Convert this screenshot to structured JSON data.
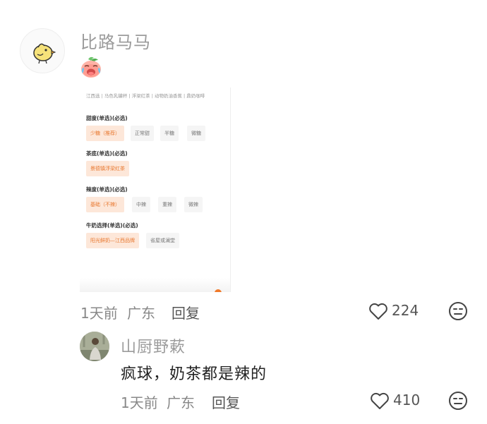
{
  "comment1": {
    "username": "比路马马",
    "avatar_icon": "chick-icon",
    "emoji_icon": "crying-laughing-peach-icon",
    "screenshot": {
      "tabs": "江西选 | 马色乳罐杯 | 浮梁红茶 | 动物奶油香蕉 | 鼎奶咖啡",
      "sections": [
        {
          "title": "甜度(单选)(必选)",
          "options": [
            "少糖（推荐）",
            "正常甜",
            "半糖",
            "微糖"
          ],
          "selected": 0
        },
        {
          "title": "茶底(单选)(必选)",
          "options": [
            "景德镇浮梁红茶"
          ],
          "selected": 0
        },
        {
          "title": "辣度(单选)(必选)",
          "options": [
            "基础（不辣）",
            "中辣",
            "重辣",
            "微辣"
          ],
          "selected": 0
        },
        {
          "title": "牛奶选择(单选)(必选)",
          "options": [
            "阳光鲜奶—江西品牌",
            "省屋或澜堂"
          ],
          "selected": 0
        }
      ]
    },
    "time": "1天前",
    "location": "广东",
    "reply_label": "回复",
    "like_count": "224",
    "like_icon": "heart-outline-icon",
    "reaction_icon": "meh-face-icon"
  },
  "comment2": {
    "username": "山厨野蔌",
    "avatar_icon": "person-photo-avatar",
    "text": "疯球，奶茶都是辣的",
    "time": "1天前",
    "location": "广东",
    "reply_label": "回复",
    "like_count": "410",
    "like_icon": "heart-outline-icon",
    "reaction_icon": "meh-face-icon"
  },
  "colors": {
    "accent": "#e8772e",
    "chip_selected_bg": "#fde7d9",
    "meta_text": "#888888"
  }
}
